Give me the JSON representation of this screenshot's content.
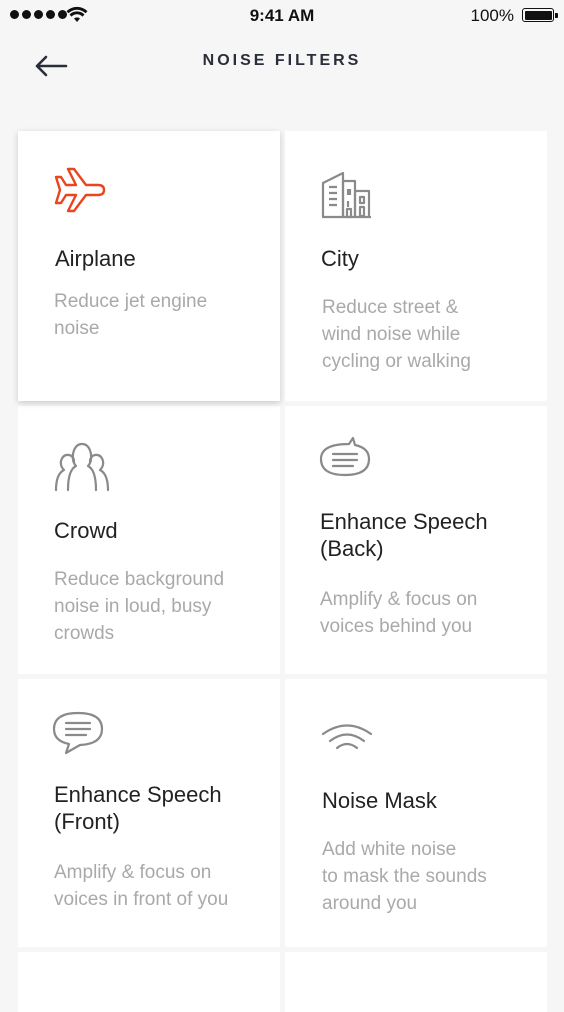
{
  "status_bar": {
    "time": "9:41 AM",
    "battery_percent": "100%",
    "signal_icon": "signal-dots-icon",
    "wifi_icon": "wifi-icon",
    "battery_icon": "battery-icon"
  },
  "header": {
    "title": "NOISE FILTERS",
    "back_icon": "arrow-left-icon"
  },
  "colors": {
    "accent": "#e8461e",
    "icon_gray": "#8a8a8a",
    "description_gray": "#a9a9a9",
    "background": "#f6f6f6"
  },
  "filters": [
    {
      "name": "Airplane",
      "description": "Reduce jet engine\nnoise",
      "icon": "airplane-icon",
      "selected": true
    },
    {
      "name": "City",
      "description": "Reduce street &\nwind noise while\ncycling or walking",
      "icon": "city-buildings-icon",
      "selected": false
    },
    {
      "name": "Crowd",
      "description": "Reduce background\nnoise in loud, busy\ncrowds",
      "icon": "crowd-icon",
      "selected": false
    },
    {
      "name": "Enhance Speech\n(Back)",
      "description": "Amplify & focus on\nvoices behind you",
      "icon": "speech-back-icon",
      "selected": false
    },
    {
      "name": "Enhance Speech\n(Front)",
      "description": "Amplify & focus on\nvoices in front of you",
      "icon": "speech-front-icon",
      "selected": false
    },
    {
      "name": "Noise Mask",
      "description": "Add white noise\nto mask the sounds\naround you",
      "icon": "noise-mask-icon",
      "selected": false
    }
  ]
}
